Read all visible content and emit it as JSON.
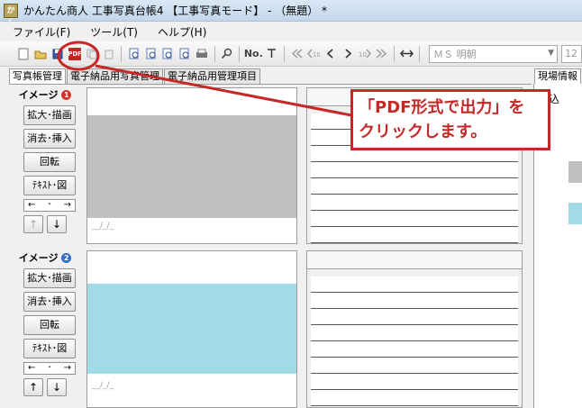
{
  "window": {
    "title": "かんたん商人 工事写真台帳4 【工事写真モード】 - （無題） *",
    "logo_text": "かん"
  },
  "menu": {
    "items": [
      "ファイル(F)",
      "ツール(T)",
      "ヘルプ(H)"
    ]
  },
  "toolbar": {
    "icons": [
      "new-file",
      "open-folder",
      "save",
      "pdf-export",
      "copy",
      "paste",
      "preview-1",
      "preview-2",
      "preview-3",
      "preview-4",
      "print",
      "find",
      "numbering",
      "text-tool",
      "first-page",
      "prev-10",
      "prev",
      "next",
      "next-10",
      "last-page",
      "fit-width"
    ],
    "pdf_label": "PDF",
    "numbering_label": "No.",
    "font_value": "ＭＳ 明朝",
    "size_value": "12"
  },
  "tabs": [
    "写真帳管理",
    "電子納品用写真管理",
    "電子納品用管理項目"
  ],
  "right_tab": "現場情報",
  "right_panel": {
    "header": "読込"
  },
  "images": [
    {
      "label": "イメージ",
      "badge": "❶",
      "buttons": [
        "拡大･描画",
        "消去･挿入",
        "回転",
        "ﾃｷｽﾄ･図"
      ],
      "arrows": [
        "←",
        "･",
        "→"
      ],
      "up": "↑",
      "down": "↓",
      "date": "__/_/_",
      "photo_color": "#c0c0c0"
    },
    {
      "label": "イメージ",
      "badge": "❷",
      "buttons": [
        "拡大･描画",
        "消去･挿入",
        "回転",
        "ﾃｷｽﾄ･図"
      ],
      "arrows": [
        "←",
        "･",
        "→"
      ],
      "up": "↑",
      "down": "↓",
      "date": "__/_/_",
      "photo_color": "#a2dbe8"
    }
  ],
  "annotation": {
    "line1": "「PDF形式で出力」を",
    "line2": "クリックします。",
    "color": "#c62828"
  }
}
